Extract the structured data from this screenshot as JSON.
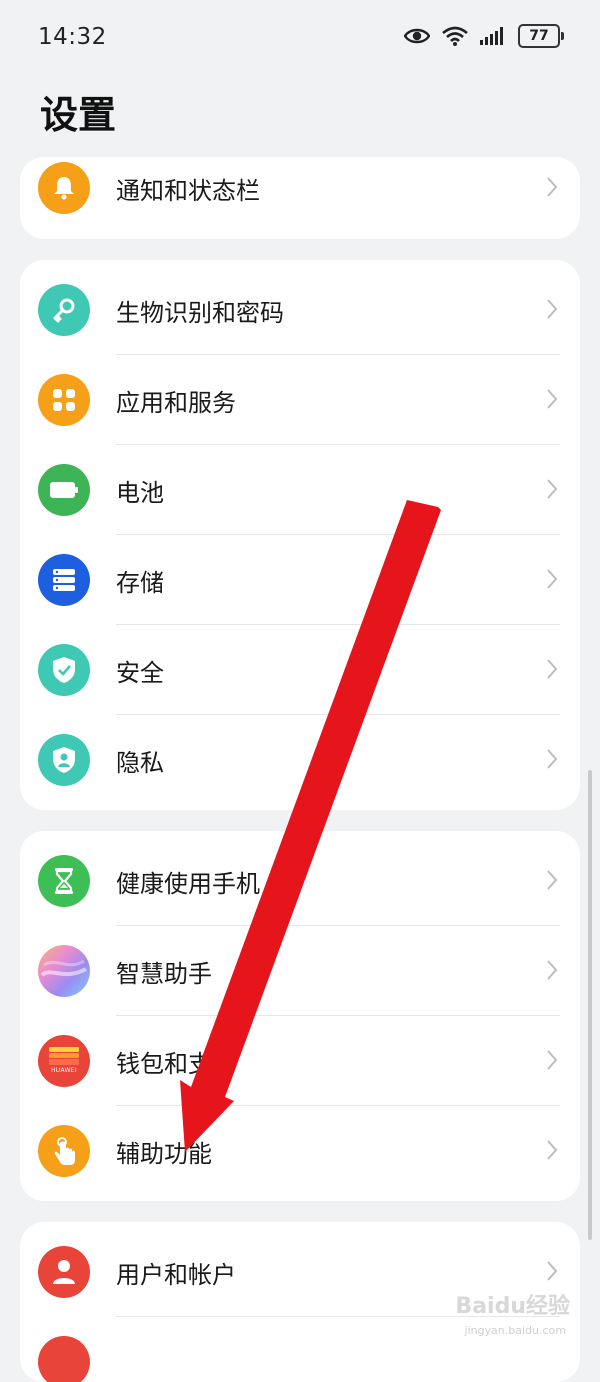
{
  "status_bar": {
    "time": "14:32",
    "battery": "77"
  },
  "title": "设置",
  "groups": [
    {
      "items": [
        {
          "label": "通知和状态栏",
          "icon": "bell-icon",
          "color": "#f6a01a"
        }
      ]
    },
    {
      "items": [
        {
          "label": "生物识别和密码",
          "icon": "key-icon",
          "color": "#3fc8b4"
        },
        {
          "label": "应用和服务",
          "icon": "apps-icon",
          "color": "#f6a01a"
        },
        {
          "label": "电池",
          "icon": "battery-icon",
          "color": "#3db456"
        },
        {
          "label": "存储",
          "icon": "storage-icon",
          "color": "#1e5fe0"
        },
        {
          "label": "安全",
          "icon": "shield-check-icon",
          "color": "#3fc8b4"
        },
        {
          "label": "隐私",
          "icon": "privacy-shield-icon",
          "color": "#3fc8b4"
        }
      ]
    },
    {
      "items": [
        {
          "label": "健康使用手机",
          "icon": "hourglass-icon",
          "color": "#3dbf55"
        },
        {
          "label": "智慧助手",
          "icon": "assistant-orb-icon",
          "color": "#c98ae0"
        },
        {
          "label": "钱包和支付",
          "icon": "wallet-icon",
          "color": "#e8443a",
          "brand_text": "HUAWEI"
        },
        {
          "label": "辅助功能",
          "icon": "hand-touch-icon",
          "color": "#f6a01a"
        }
      ]
    },
    {
      "items": [
        {
          "label": "用户和帐户",
          "icon": "user-icon",
          "color": "#e8443a"
        }
      ]
    }
  ],
  "annotation_color": "#e6141b",
  "watermark": {
    "text": "Baidu经验",
    "sub": "jingyan.baidu.com"
  }
}
